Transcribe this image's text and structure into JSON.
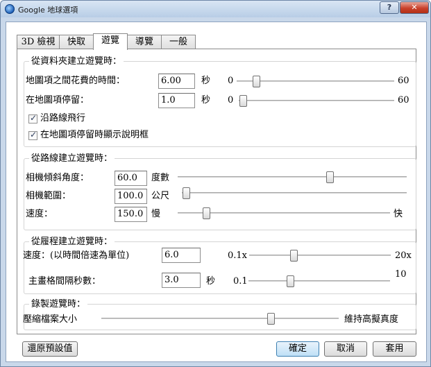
{
  "window": {
    "title": "Google 地球選項",
    "help_label": "?",
    "close_label": "✕"
  },
  "tabs": [
    "3D 檢視",
    "快取",
    "遊覽",
    "導覽",
    "一般"
  ],
  "active_tab": "遊覽",
  "folder_tour": {
    "title": "從資料夾建立遊覽時：",
    "fly_time_label": "地圖項之間花費的時間：",
    "fly_time_value": "6.00",
    "fly_time_unit": "秒",
    "fly_time_min": "0",
    "fly_time_max": "60",
    "fly_time_level": 0.1,
    "wait_label": "在地圖項停留：",
    "wait_value": "1.0",
    "wait_unit": "秒",
    "wait_min": "0",
    "wait_max": "60",
    "wait_level": 0.0,
    "fly_along_lines_label": "沿路線飛行",
    "fly_along_lines_checked": true,
    "show_balloon_label": "在地圖項停留時顯示說明框",
    "show_balloon_checked": true
  },
  "line_tour": {
    "title": "從路線建立遊覽時：",
    "tilt_label": "相機傾斜角度：",
    "tilt_value": "60.0",
    "tilt_unit": "度數",
    "tilt_level": 0.67,
    "range_label": "相機範圍：",
    "range_value": "100.0",
    "range_unit": "公尺",
    "range_level": 0.0,
    "speed_label": "速度：",
    "speed_value": "150.0",
    "speed_min": "慢",
    "speed_max": "快",
    "speed_level": 0.12
  },
  "track_tour": {
    "title": "從履程建立遊覽時：",
    "speed_label": "速度：(以時間倍速為單位)",
    "speed_value": "6.0",
    "speed_min": "0.1x",
    "speed_max": "20x",
    "speed_level": 0.3,
    "interval_label": "主畫格間隔秒數：",
    "interval_value": "3.0",
    "interval_unit": "秒",
    "interval_min": "0.1",
    "interval_max": "10",
    "interval_level": 0.28
  },
  "recording": {
    "title": "錄製遊覽時：",
    "compress_label": "壓縮檔案大小",
    "fidelity_label": "維持高擬真度",
    "quality_level": 0.72
  },
  "buttons": {
    "restore_defaults": "還原預設值",
    "ok": "確定",
    "cancel": "取消",
    "apply": "套用"
  }
}
